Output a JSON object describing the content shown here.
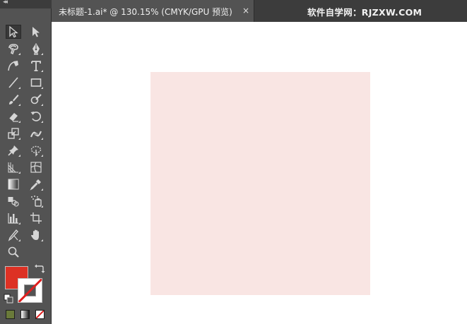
{
  "document": {
    "tab_title": "未标题-1.ai* @ 130.15% (CMYK/GPU 预览)",
    "close_glyph": "×",
    "watermark": "软件自学网：RJZXW.COM"
  },
  "toolbar": {
    "collapse_glyph": "◂◂",
    "tools": [
      {
        "name": "selection-tool",
        "icon": "selection-arrow"
      },
      {
        "name": "direct-selection-tool",
        "icon": "direct-selection-arrow"
      },
      {
        "name": "magic-wand-tool",
        "icon": "magic-wand"
      },
      {
        "name": "pen-tool",
        "icon": "pen-nib"
      },
      {
        "name": "curvature-tool",
        "icon": "curvature-pen"
      },
      {
        "name": "type-tool",
        "icon": "type-t",
        "label": "T"
      },
      {
        "name": "line-segment-tool",
        "icon": "line"
      },
      {
        "name": "rectangle-tool",
        "icon": "rectangle"
      },
      {
        "name": "paintbrush-tool",
        "icon": "paintbrush"
      },
      {
        "name": "shaper-tool",
        "icon": "shaper"
      },
      {
        "name": "eraser-tool",
        "icon": "eraser"
      },
      {
        "name": "rotate-tool",
        "icon": "rotate"
      },
      {
        "name": "scale-tool",
        "icon": "scale"
      },
      {
        "name": "width-tool",
        "icon": "width"
      },
      {
        "name": "puppet-warp-tool",
        "icon": "pushpin"
      },
      {
        "name": "free-transform-tool",
        "icon": "free-transform"
      },
      {
        "name": "perspective-grid-tool",
        "icon": "perspective-grid"
      },
      {
        "name": "mesh-tool",
        "icon": "mesh"
      },
      {
        "name": "gradient-tool",
        "icon": "gradient"
      },
      {
        "name": "eyedropper-tool",
        "icon": "eyedropper"
      },
      {
        "name": "blend-tool",
        "icon": "blend"
      },
      {
        "name": "symbol-sprayer-tool",
        "icon": "symbol-sprayer"
      },
      {
        "name": "column-graph-tool",
        "icon": "column-graph"
      },
      {
        "name": "artboard-tool",
        "icon": "artboard"
      },
      {
        "name": "slice-tool",
        "icon": "slice"
      },
      {
        "name": "hand-tool",
        "icon": "hand"
      },
      {
        "name": "zoom-tool",
        "icon": "magnifier"
      }
    ],
    "active_tool": "selection-tool",
    "fill_color": "#dd3124",
    "stroke": "none"
  },
  "canvas": {
    "background": "#ffffff",
    "artboard_fill": "#f9e5e3"
  },
  "colors": {
    "panel": "#535353",
    "panel_dark": "#3c3c3c",
    "icon": "#d6d6d6"
  }
}
